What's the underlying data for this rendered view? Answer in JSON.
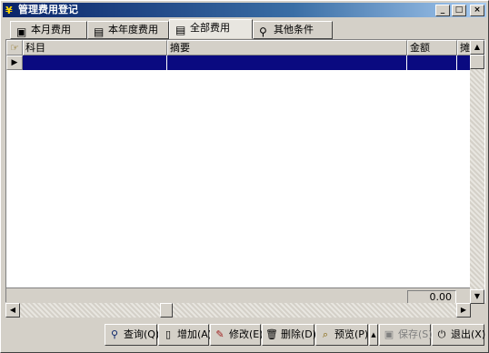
{
  "window": {
    "title": "管理费用登记",
    "app_icon": "app-icon",
    "controls": {
      "minimize": "_",
      "maximize": "□",
      "close": "×"
    }
  },
  "tabs": [
    {
      "label": "本月费用",
      "icon": "calendar-month-icon",
      "active": false
    },
    {
      "label": "本年度费用",
      "icon": "calendar-year-icon",
      "active": false
    },
    {
      "label": "全部费用",
      "icon": "printer-icon",
      "active": true
    },
    {
      "label": "其他条件",
      "icon": "magnifier-icon",
      "active": false
    }
  ],
  "grid": {
    "columns": [
      "科目",
      "摘要",
      "金额",
      "摊销"
    ],
    "rows": [
      {
        "科目": "",
        "摘要": "",
        "金额": "",
        "摊销": ""
      }
    ],
    "total": "0.00"
  },
  "toolbar": {
    "buttons": [
      {
        "label": "查询(Q)",
        "icon": "query-icon",
        "enabled": true
      },
      {
        "label": "增加(A)",
        "icon": "add-icon",
        "enabled": true
      },
      {
        "label": "修改(E)",
        "icon": "edit-icon",
        "enabled": true
      },
      {
        "label": "删除(D)",
        "icon": "delete-icon",
        "enabled": true
      },
      {
        "label": "预览(P)",
        "icon": "preview-icon",
        "enabled": true
      },
      {
        "label": "保存(S)",
        "icon": "save-icon",
        "enabled": false
      },
      {
        "label": "退出(X)",
        "icon": "exit-icon",
        "enabled": true
      }
    ]
  },
  "colors": {
    "face": "#d4d0c8",
    "title_gradient_start": "#0a246a",
    "selection": "#0a0a80"
  }
}
